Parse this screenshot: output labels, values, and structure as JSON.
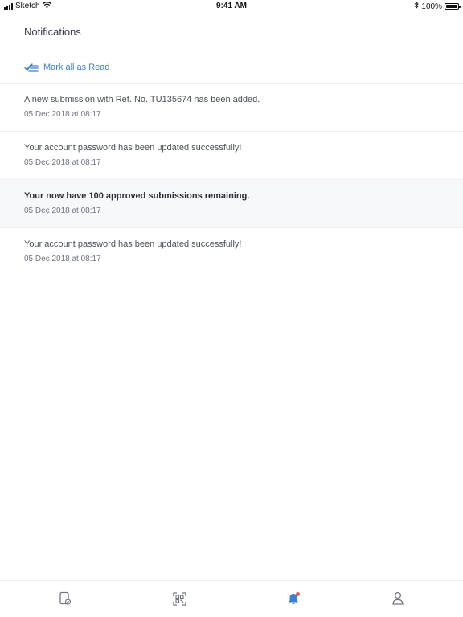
{
  "status_bar": {
    "carrier": "Sketch",
    "time": "9:41 AM",
    "battery": "100%",
    "icons": [
      "signal-icon",
      "wifi-icon",
      "bluetooth-icon",
      "battery-icon"
    ]
  },
  "header": {
    "title": "Notifications"
  },
  "mark_all": {
    "label": "Mark all as Read",
    "icon": "mark-read-icon",
    "color": "#3a7fd5"
  },
  "notifications": [
    {
      "message": "A new submission with Ref. No. TU135674 has been added.",
      "time": "05 Dec 2018 at 08:17",
      "unread": false
    },
    {
      "message": "Your account password has been updated successfully!",
      "time": "05 Dec 2018 at 08:17",
      "unread": false
    },
    {
      "message": "Your now have 100 approved submissions remaining.",
      "time": "05 Dec 2018 at 08:17",
      "unread": true
    },
    {
      "message": "Your account password has been updated successfully!",
      "time": "05 Dec 2018 at 08:17",
      "unread": false
    }
  ],
  "tab_bar": {
    "tabs": [
      {
        "icon": "document-icon",
        "active": false
      },
      {
        "icon": "qr-scan-icon",
        "active": false
      },
      {
        "icon": "bell-icon",
        "active": true,
        "badge": true
      },
      {
        "icon": "user-icon",
        "active": false
      }
    ],
    "active_color": "#3a7fd5",
    "inactive_color": "#6f7480",
    "badge_color": "#e85a5a"
  }
}
